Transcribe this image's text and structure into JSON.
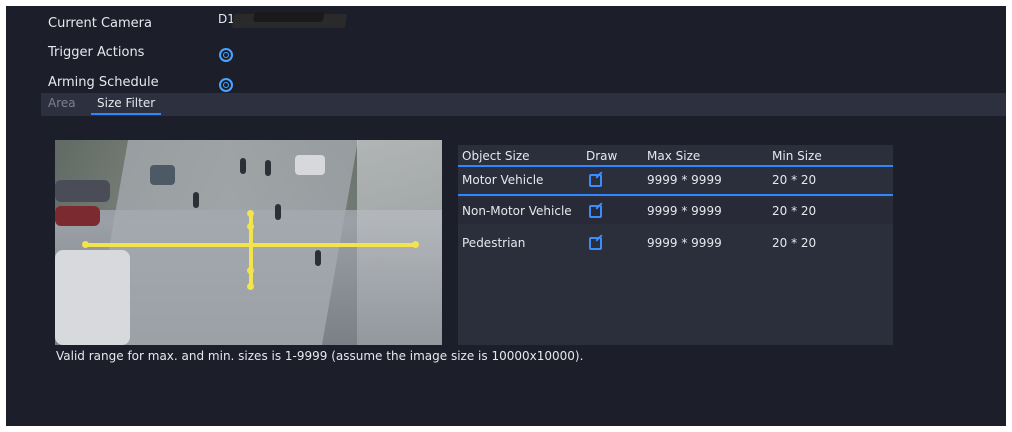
{
  "form": {
    "current_camera_label": "Current Camera",
    "current_camera_value": "D1",
    "trigger_actions_label": "Trigger Actions",
    "arming_schedule_label": "Arming Schedule"
  },
  "tabs": [
    {
      "label": "Area",
      "active": false
    },
    {
      "label": "Size Filter",
      "active": true
    }
  ],
  "table": {
    "headers": [
      "Object Size",
      "Draw",
      "Max Size",
      "Min Size"
    ],
    "rows": [
      {
        "object": "Motor Vehicle",
        "max": "9999 * 9999",
        "min": "20 * 20"
      },
      {
        "object": "Non-Motor Vehicle",
        "max": "9999 * 9999",
        "min": "20 * 20"
      },
      {
        "object": "Pedestrian",
        "max": "9999 * 9999",
        "min": "20 * 20"
      }
    ]
  },
  "note": "Valid range for max. and min. sizes is 1-9999 (assume the image size is 10000x10000).",
  "colors": {
    "accent": "#2f86ff",
    "drawing": "#f2e44a",
    "panel": "#1c1f2a"
  },
  "icons": {
    "settings": "gear-icon",
    "draw": "edit-icon"
  }
}
